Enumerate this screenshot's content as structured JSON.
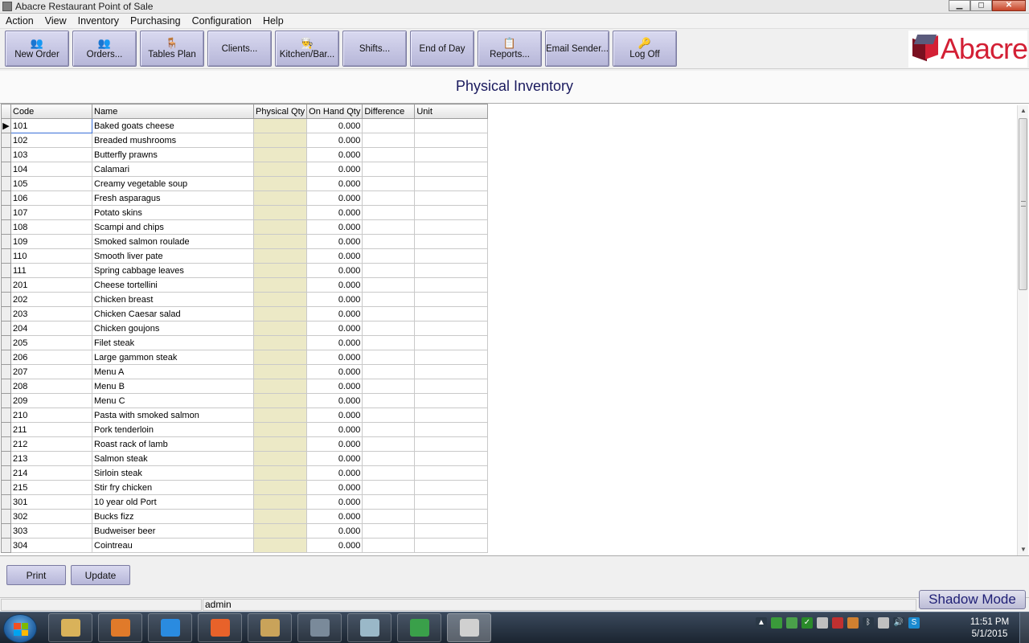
{
  "window": {
    "title": "Abacre Restaurant Point of Sale",
    "controls": {
      "minimize": "▁",
      "maximize": "◻",
      "close": "✕"
    }
  },
  "menu": [
    "Action",
    "View",
    "Inventory",
    "Purchasing",
    "Configuration",
    "Help"
  ],
  "toolbar": {
    "buttons": [
      {
        "label": "New Order",
        "icon": "new-order-icon",
        "glyph": "👥"
      },
      {
        "label": "Orders...",
        "icon": "orders-icon",
        "glyph": "👥"
      },
      {
        "label": "Tables Plan",
        "icon": "tables-plan-icon",
        "glyph": "🪑"
      },
      {
        "label": "Clients...",
        "icon": "",
        "glyph": ""
      },
      {
        "label": "Kitchen/Bar...",
        "icon": "kitchen-bar-icon",
        "glyph": "👨‍🍳"
      },
      {
        "label": "Shifts...",
        "icon": "",
        "glyph": ""
      },
      {
        "label": "End of Day",
        "icon": "",
        "glyph": ""
      },
      {
        "label": "Reports...",
        "icon": "reports-icon",
        "glyph": "📋"
      },
      {
        "label": "Email Sender...",
        "icon": "",
        "glyph": ""
      },
      {
        "label": "Log Off",
        "icon": "log-off-key-icon",
        "glyph": "🔑"
      }
    ]
  },
  "logo": {
    "text": "Abacre"
  },
  "page_title": "Physical Inventory",
  "grid": {
    "columns": [
      "Code",
      "Name",
      "Physical Qty",
      "On Hand Qty",
      "Difference",
      "Unit"
    ],
    "row_pointer": "▶",
    "rows": [
      {
        "code": "101",
        "name": "Baked goats cheese",
        "physical": "",
        "onhand": "0.000",
        "difference": "",
        "unit": ""
      },
      {
        "code": "102",
        "name": "Breaded mushrooms",
        "physical": "",
        "onhand": "0.000",
        "difference": "",
        "unit": ""
      },
      {
        "code": "103",
        "name": "Butterfly prawns",
        "physical": "",
        "onhand": "0.000",
        "difference": "",
        "unit": ""
      },
      {
        "code": "104",
        "name": "Calamari",
        "physical": "",
        "onhand": "0.000",
        "difference": "",
        "unit": ""
      },
      {
        "code": "105",
        "name": "Creamy vegetable soup",
        "physical": "",
        "onhand": "0.000",
        "difference": "",
        "unit": ""
      },
      {
        "code": "106",
        "name": "Fresh asparagus",
        "physical": "",
        "onhand": "0.000",
        "difference": "",
        "unit": ""
      },
      {
        "code": "107",
        "name": "Potato skins",
        "physical": "",
        "onhand": "0.000",
        "difference": "",
        "unit": ""
      },
      {
        "code": "108",
        "name": "Scampi and chips",
        "physical": "",
        "onhand": "0.000",
        "difference": "",
        "unit": ""
      },
      {
        "code": "109",
        "name": "Smoked salmon roulade",
        "physical": "",
        "onhand": "0.000",
        "difference": "",
        "unit": ""
      },
      {
        "code": "110",
        "name": "Smooth liver pate",
        "physical": "",
        "onhand": "0.000",
        "difference": "",
        "unit": ""
      },
      {
        "code": "111",
        "name": "Spring cabbage leaves",
        "physical": "",
        "onhand": "0.000",
        "difference": "",
        "unit": ""
      },
      {
        "code": "201",
        "name": "Cheese tortellini",
        "physical": "",
        "onhand": "0.000",
        "difference": "",
        "unit": ""
      },
      {
        "code": "202",
        "name": "Chicken breast",
        "physical": "",
        "onhand": "0.000",
        "difference": "",
        "unit": ""
      },
      {
        "code": "203",
        "name": "Chicken Caesar salad",
        "physical": "",
        "onhand": "0.000",
        "difference": "",
        "unit": ""
      },
      {
        "code": "204",
        "name": "Chicken goujons",
        "physical": "",
        "onhand": "0.000",
        "difference": "",
        "unit": ""
      },
      {
        "code": "205",
        "name": "Filet steak",
        "physical": "",
        "onhand": "0.000",
        "difference": "",
        "unit": ""
      },
      {
        "code": "206",
        "name": "Large gammon steak",
        "physical": "",
        "onhand": "0.000",
        "difference": "",
        "unit": ""
      },
      {
        "code": "207",
        "name": "Menu A",
        "physical": "",
        "onhand": "0.000",
        "difference": "",
        "unit": ""
      },
      {
        "code": "208",
        "name": "Menu B",
        "physical": "",
        "onhand": "0.000",
        "difference": "",
        "unit": ""
      },
      {
        "code": "209",
        "name": "Menu C",
        "physical": "",
        "onhand": "0.000",
        "difference": "",
        "unit": ""
      },
      {
        "code": "210",
        "name": "Pasta with smoked salmon",
        "physical": "",
        "onhand": "0.000",
        "difference": "",
        "unit": ""
      },
      {
        "code": "211",
        "name": "Pork tenderloin",
        "physical": "",
        "onhand": "0.000",
        "difference": "",
        "unit": ""
      },
      {
        "code": "212",
        "name": "Roast rack of lamb",
        "physical": "",
        "onhand": "0.000",
        "difference": "",
        "unit": ""
      },
      {
        "code": "213",
        "name": "Salmon steak",
        "physical": "",
        "onhand": "0.000",
        "difference": "",
        "unit": ""
      },
      {
        "code": "214",
        "name": "Sirloin steak",
        "physical": "",
        "onhand": "0.000",
        "difference": "",
        "unit": ""
      },
      {
        "code": "215",
        "name": "Stir fry chicken",
        "physical": "",
        "onhand": "0.000",
        "difference": "",
        "unit": ""
      },
      {
        "code": "301",
        "name": "10 year old Port",
        "physical": "",
        "onhand": "0.000",
        "difference": "",
        "unit": ""
      },
      {
        "code": "302",
        "name": "Bucks fizz",
        "physical": "",
        "onhand": "0.000",
        "difference": "",
        "unit": ""
      },
      {
        "code": "303",
        "name": "Budweiser beer",
        "physical": "",
        "onhand": "0.000",
        "difference": "",
        "unit": ""
      },
      {
        "code": "304",
        "name": "Cointreau",
        "physical": "",
        "onhand": "0.000",
        "difference": "",
        "unit": ""
      }
    ]
  },
  "scrollbar": {
    "up": "▲",
    "down": "▼"
  },
  "actions": {
    "print_label": "Print",
    "update_label": "Update"
  },
  "status": {
    "user": "admin",
    "shadow_mode_label": "Shadow Mode"
  },
  "taskbar": {
    "apps": [
      {
        "icon": "file-explorer-icon",
        "color": "#d9b25a",
        "active": false
      },
      {
        "icon": "media-player-icon",
        "color": "#e07a2a",
        "active": false
      },
      {
        "icon": "internet-explorer-icon",
        "color": "#2a8be0",
        "active": false
      },
      {
        "icon": "firefox-icon",
        "color": "#e8622a",
        "active": false
      },
      {
        "icon": "notepad-icon",
        "color": "#c9a35a",
        "active": false
      },
      {
        "icon": "server-app-icon",
        "color": "#7a8a9a",
        "active": false
      },
      {
        "icon": "book-app-icon",
        "color": "#9ab8c8",
        "active": false
      },
      {
        "icon": "globe-icon",
        "color": "#3aa04a",
        "active": false
      },
      {
        "icon": "abacre-pos-icon",
        "color": "#d0d0d0",
        "active": true
      }
    ],
    "tray": [
      {
        "icon": "show-hidden-icons-icon",
        "glyph": "▲",
        "color": "#2a3846"
      },
      {
        "icon": "tray-app-icon",
        "glyph": "",
        "color": "#3a9a3a"
      },
      {
        "icon": "tray-refresh-icon",
        "glyph": "",
        "color": "#4aa04a"
      },
      {
        "icon": "tray-check-icon",
        "glyph": "✓",
        "color": "#2a8a2a"
      },
      {
        "icon": "tray-tool-icon",
        "glyph": "",
        "color": "#c0c0c0"
      },
      {
        "icon": "tray-shield-icon",
        "glyph": "",
        "color": "#c03030"
      },
      {
        "icon": "tray-flag-icon",
        "glyph": "",
        "color": "#d08030"
      },
      {
        "icon": "bluetooth-icon",
        "glyph": "ᛒ",
        "color": "#2a3846"
      },
      {
        "icon": "network-icon",
        "glyph": "",
        "color": "#c0c0c0"
      },
      {
        "icon": "volume-icon",
        "glyph": "🔊",
        "color": "#2a3846"
      },
      {
        "icon": "skype-icon",
        "glyph": "S",
        "color": "#1a8ad0"
      }
    ],
    "clock_time": "11:51 PM",
    "clock_date": "5/1/2015"
  }
}
